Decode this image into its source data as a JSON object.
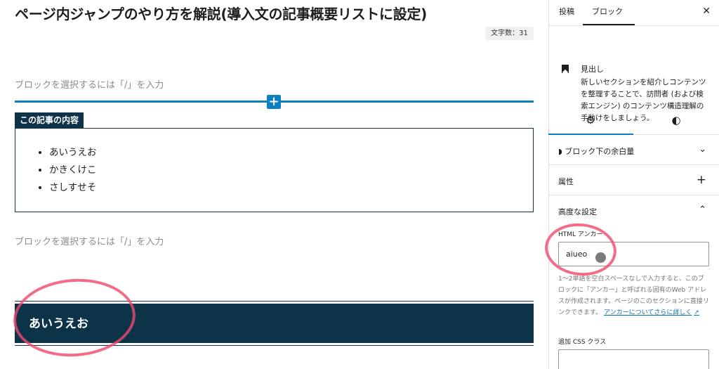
{
  "editor": {
    "post_title": "ページ内ジャンプのやり方を解説(導入文の記事概要リストに設定)",
    "word_count": "文字数：31",
    "placeholder_1": "ブロックを選択するには「/」を入力",
    "placeholder_2": "ブロックを選択するには「/」を入力",
    "inserter_symbol": "+",
    "summary_label": "この記事の内容",
    "summary_items": [
      "あいうえお",
      "かきくけこ",
      "さしすせそ"
    ],
    "heading_text": "あいうえお"
  },
  "sidebar": {
    "tabs": {
      "post": "投稿",
      "block": "ブロック"
    },
    "close_symbol": "✕",
    "block_card": {
      "icon": "bookmark-icon",
      "name": "見出し",
      "description": "新しいセクションを紹介しコンテンツを整理することで、訪問者 (および検索エンジン) のコンテンツ構造理解の手助けをしましょう。"
    },
    "style_tabs": {
      "settings_icon": "⚙",
      "styles_icon": "◐"
    },
    "panels": {
      "spacing": {
        "icon_glyph": "◗",
        "title": "ブロック下の余白量",
        "toggle": "⌄"
      },
      "attributes": {
        "title": "属性",
        "toggle": "+"
      },
      "advanced": {
        "title": "高度な設定",
        "toggle": "⌃"
      }
    },
    "advanced": {
      "anchor_label": "HTML アンカー",
      "anchor_value": "aiueo",
      "help_text": "1〜2単語を空白スペースなしで入力すると、このブロックに「アンカー」と呼ばれる固有のWeb アドレスが作成されます。ページのこのセクションに直接リンクできます。",
      "help_link": "アンカーについてさらに詳しく",
      "help_link_arrow": "↗",
      "css_label": "追加 CSS クラス",
      "css_value": ""
    }
  },
  "colors": {
    "accent": "#0a7fc1",
    "heading_bg": "#0d3349",
    "annotation": "#f0486e"
  }
}
